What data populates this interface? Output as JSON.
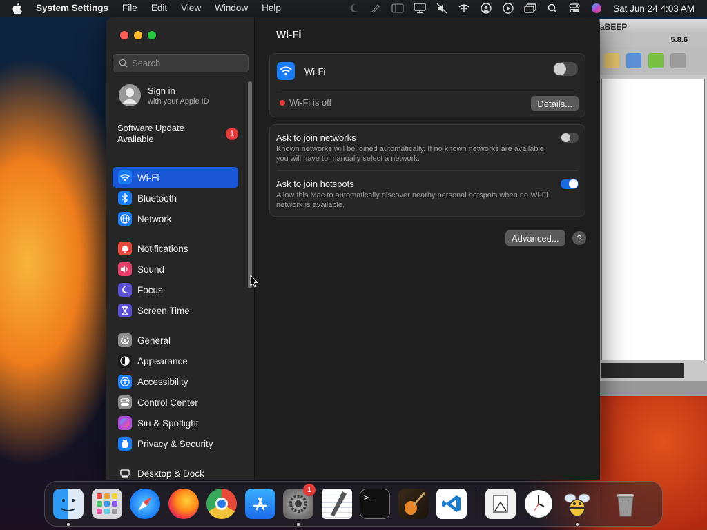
{
  "menubar": {
    "app_name": "System Settings",
    "menus": [
      "File",
      "Edit",
      "View",
      "Window",
      "Help"
    ],
    "clock": "Sat Jun 24  4:03 AM"
  },
  "background_window": {
    "title": "aBEEP",
    "version": "5.8.6"
  },
  "sidebar": {
    "search_placeholder": "Search",
    "account": {
      "title": "Sign in",
      "subtitle": "with your Apple ID"
    },
    "software_update": {
      "label": "Software Update Available",
      "badge": "1"
    },
    "items": [
      {
        "label": "Wi-Fi",
        "icon": "wifi-icon",
        "color": "#1a7cf5",
        "active": true
      },
      {
        "label": "Bluetooth",
        "icon": "bluetooth-icon",
        "color": "#1a7cf5"
      },
      {
        "label": "Network",
        "icon": "globe-icon",
        "color": "#1a7cf5"
      },
      {
        "label": "Notifications",
        "icon": "bell-icon",
        "color": "#e8463b"
      },
      {
        "label": "Sound",
        "icon": "speaker-icon",
        "color": "#e8406a"
      },
      {
        "label": "Focus",
        "icon": "moon-icon",
        "color": "#5b4fd6"
      },
      {
        "label": "Screen Time",
        "icon": "hourglass-icon",
        "color": "#5b4fd6"
      },
      {
        "label": "General",
        "icon": "gear-icon",
        "color": "#8e8e8e"
      },
      {
        "label": "Appearance",
        "icon": "appearance-icon",
        "color": "#1c1c1c"
      },
      {
        "label": "Accessibility",
        "icon": "accessibility-icon",
        "color": "#1a7cf5"
      },
      {
        "label": "Control Center",
        "icon": "control-center-icon",
        "color": "#8e8e8e"
      },
      {
        "label": "Siri & Spotlight",
        "icon": "siri-icon",
        "color": "#b44bd8"
      },
      {
        "label": "Privacy & Security",
        "icon": "hand-icon",
        "color": "#1a7cf5"
      },
      {
        "label": "Desktop & Dock",
        "icon": "desktop-icon",
        "color": "#2a2a2a"
      }
    ]
  },
  "content": {
    "title": "Wi-Fi",
    "wifi_label": "Wi-Fi",
    "wifi_enabled": false,
    "status_text": "Wi-Fi is off",
    "details_button": "Details...",
    "ask_networks": {
      "title": "Ask to join networks",
      "description": "Known networks will be joined automatically. If no known networks are available, you will have to manually select a network.",
      "enabled": false
    },
    "ask_hotspots": {
      "title": "Ask to join hotspots",
      "description": "Allow this Mac to automatically discover nearby personal hotspots when no Wi-Fi network is available.",
      "enabled": true
    },
    "advanced_button": "Advanced...",
    "help_button": "?"
  },
  "dock": {
    "settings_badge": "1",
    "apps": [
      "Finder",
      "Launchpad",
      "Safari",
      "Firefox",
      "Chrome",
      "App Store",
      "System Settings",
      "TextEdit",
      "Terminal",
      "GarageBand",
      "Visual Studio Code",
      "Preview",
      "Clock",
      "aBEEP",
      "Trash"
    ]
  }
}
